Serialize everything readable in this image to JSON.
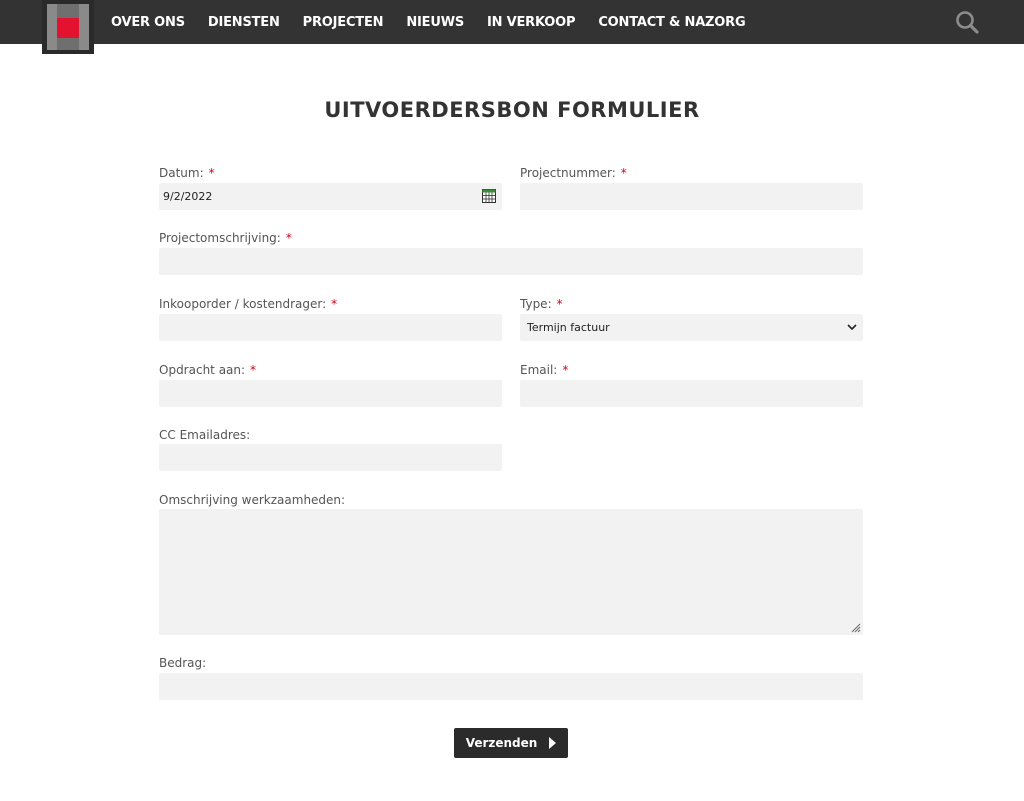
{
  "nav": {
    "items": [
      "OVER ONS",
      "DIENSTEN",
      "PROJECTEN",
      "NIEUWS",
      "IN VERKOOP",
      "CONTACT & NAZORG"
    ]
  },
  "page": {
    "title": "UITVOERDERSBON FORMULIER"
  },
  "form": {
    "required_marker": "*",
    "datum": {
      "label": "Datum:",
      "value": "9/2/2022"
    },
    "projectnummer": {
      "label": "Projectnummer:",
      "value": ""
    },
    "projectomschrijving": {
      "label": "Projectomschrijving:",
      "value": ""
    },
    "inkooporder": {
      "label": "Inkooporder / kostendrager:",
      "value": ""
    },
    "type": {
      "label": "Type:",
      "value": "Termijn factuur"
    },
    "opdracht": {
      "label": "Opdracht aan:",
      "value": ""
    },
    "email": {
      "label": "Email:",
      "value": ""
    },
    "cc": {
      "label": "CC Emailadres:",
      "value": ""
    },
    "omschrijving": {
      "label": "Omschrijving werkzaamheden:",
      "value": ""
    },
    "bedrag": {
      "label": "Bedrag:",
      "value": ""
    },
    "submit_label": "Verzenden"
  },
  "colors": {
    "header_bg": "#333333",
    "brand_red": "#e3132f",
    "field_bg": "#f2f2f2",
    "required": "#d0021b",
    "button_bg": "#2b2b2b"
  },
  "icons": {
    "search": "search-icon",
    "calendar": "calendar-icon",
    "select": "chevron-down-icon",
    "submit": "play-arrow-icon"
  }
}
